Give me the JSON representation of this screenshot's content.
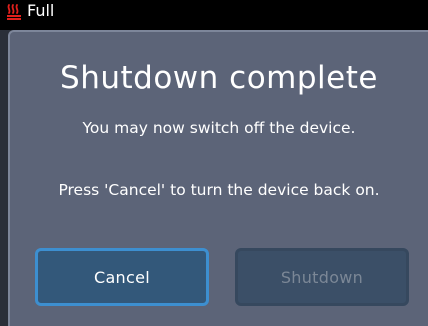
{
  "status_bar": {
    "icon": "heater-icon",
    "label": "Full",
    "icon_color": "#e0201c"
  },
  "dialog": {
    "title": "Shutdown complete",
    "message_1": "You may now switch off the device.",
    "message_2": "Press 'Cancel' to turn the device back on.",
    "cancel_label": "Cancel",
    "shutdown_label": "Shutdown",
    "shutdown_enabled": false
  },
  "colors": {
    "dialog_bg": "#5c6478",
    "focus_border": "#3d8fd0",
    "status_bg": "#000000"
  }
}
